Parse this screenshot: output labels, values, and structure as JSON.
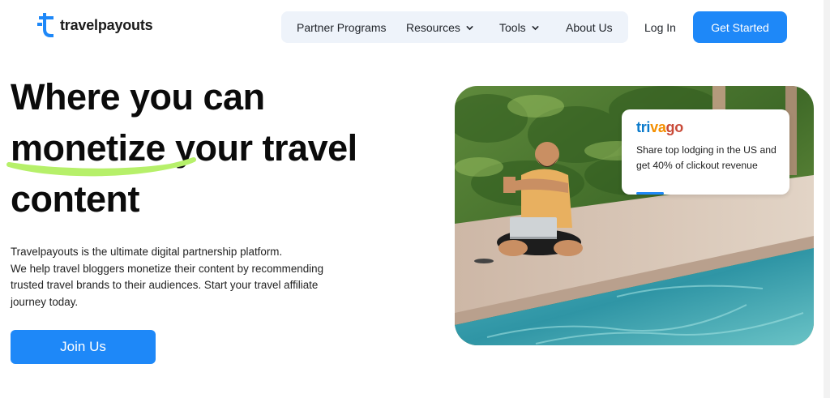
{
  "brand": {
    "name": "travelpayouts",
    "accent_color": "#1e88f8"
  },
  "nav": {
    "items": [
      {
        "label": "Partner Programs",
        "has_dropdown": false
      },
      {
        "label": "Resources",
        "has_dropdown": true
      },
      {
        "label": "Tools",
        "has_dropdown": true
      },
      {
        "label": "About Us",
        "has_dropdown": false
      }
    ],
    "login_label": "Log In",
    "cta_label": "Get Started"
  },
  "hero": {
    "headline_line1": "Where you can",
    "headline_highlight": "monetize",
    "headline_line2_rest": " your travel",
    "headline_line3": "content",
    "highlight_color": "#b6f06a",
    "description": [
      "Travelpayouts is the ultimate digital partnership platform.",
      "We help travel bloggers monetize their content by recommending",
      "trusted travel brands to their audiences. Start your travel affiliate",
      "journey today."
    ],
    "button_label": "Join Us"
  },
  "promo_card": {
    "brand_parts": [
      "tri",
      "va",
      "go"
    ],
    "text": "Share top lodging in the US and get 40% of clickout revenue"
  }
}
